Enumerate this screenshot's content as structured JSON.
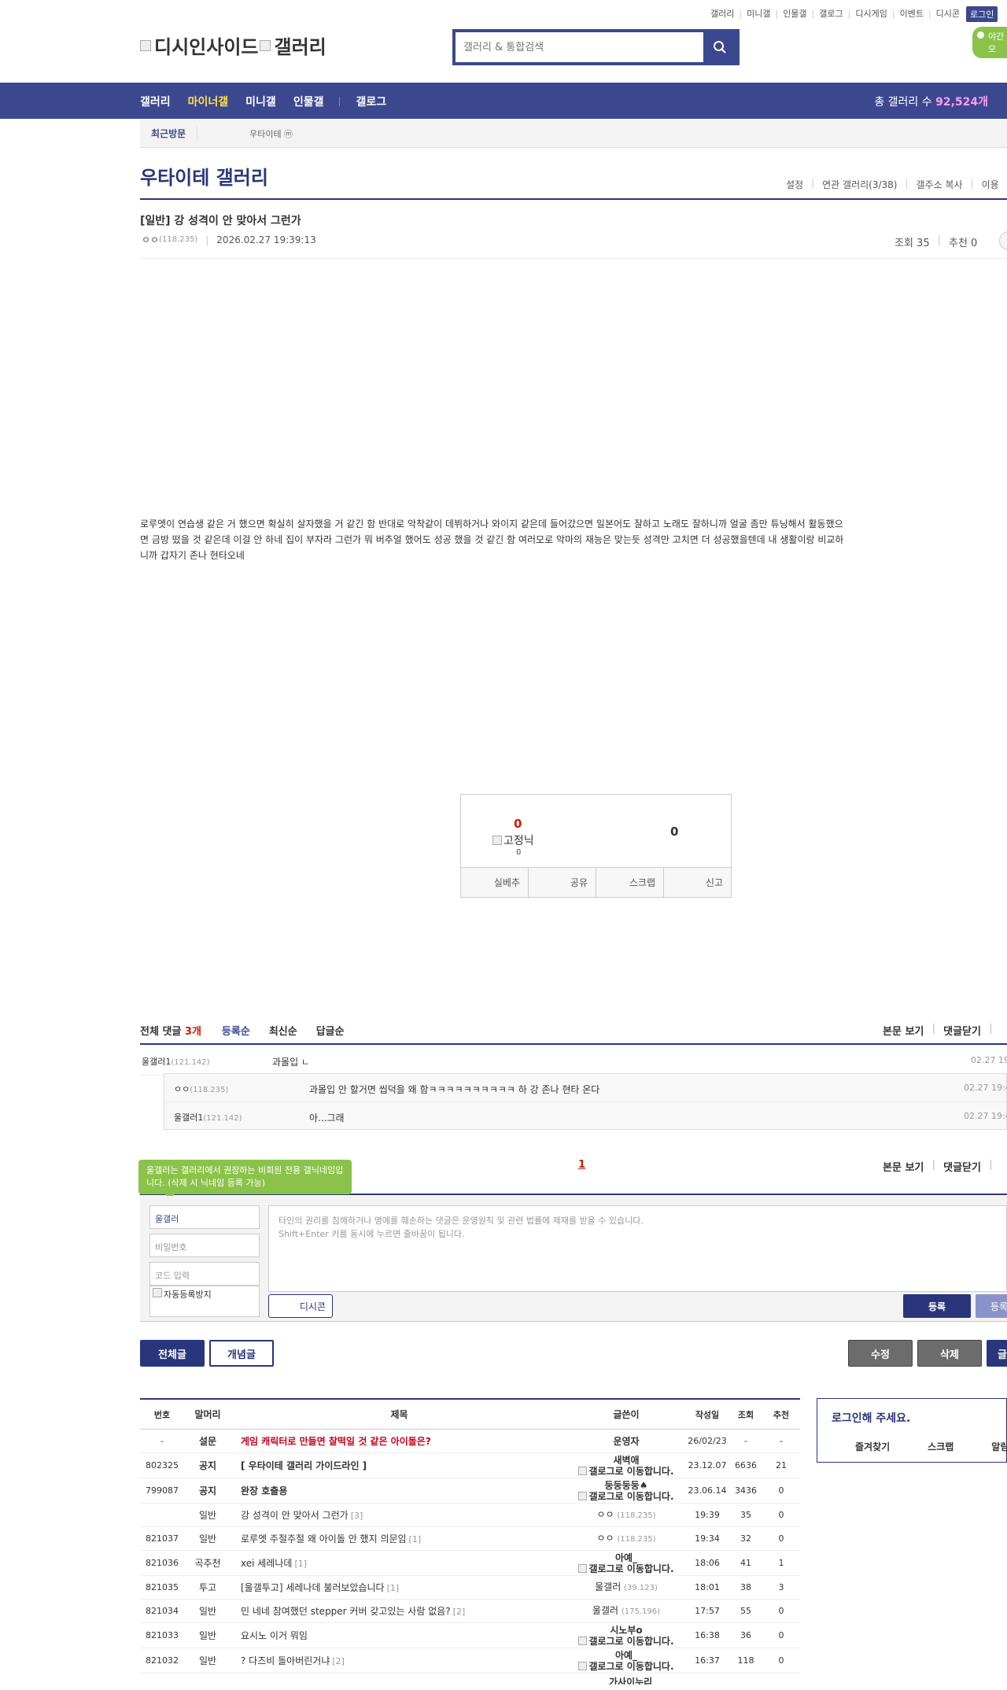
{
  "top_util": [
    "갤러리",
    "미니갤",
    "인물갤",
    "갤로그",
    "디시게임",
    "이벤트",
    "디시콘"
  ],
  "login_label": "로그인",
  "night_label": "야간 모",
  "logo": {
    "part1": "디시인사이드",
    "part2": "갤러리"
  },
  "search": {
    "placeholder": "갤러리 & 통합검색"
  },
  "nav": {
    "items": [
      "갤러리",
      "마이너갤",
      "미니갤",
      "인물갤"
    ],
    "gallog": "갤로그",
    "active": "마이너갤",
    "total_label": "총 갤러리 수",
    "total_value": "92,524개"
  },
  "recent": {
    "label": "최근방문",
    "gallery": "우타이테 ⓜ"
  },
  "gallery": {
    "title": "우타이테 갤러리",
    "tools": [
      "설정",
      "연관 갤러리(3/38)",
      "갤주소 복사",
      "이용"
    ]
  },
  "post": {
    "title": "[일반] 강 성격이 안 맞아서 그런가",
    "author": "ㅇㅇ",
    "ip": "(118.235)",
    "date": "2026.02.27 19:39:13",
    "views": "조회 35",
    "recommend": "추천 0",
    "body": "로루엣이 연습생 같은 거 했으면 확실히 살자했을 거 같긴 함 반대로 악착같이 데뷔하거나 와이지 같은데 들어갔으면 일본어도 잘하고 노래도 잘하니까 얼굴 좀만 튜닝해서 활동했으면 금방 떴을 것 같은데 이걸 안 하네 집이 부자라 그런가 뭐 버추얼 했어도 성공 했을 것 같긴 함 여러모로 악마의 재능은 맞는듯 성격만 고치면 더 성공했을텐데 내 생활이랑 비교하니까 갑자기 존나 현타오네"
  },
  "reco": {
    "up": "0",
    "fixnick": "고정닉",
    "fixnick_count": "0",
    "down": "0",
    "buttons": [
      "실베추",
      "공유",
      "스크랩",
      "신고"
    ]
  },
  "comments": {
    "total_label": "전체 댓글",
    "total_count": "3개",
    "sorts": [
      "등록순",
      "최신순",
      "답글순"
    ],
    "view_body": "본문 보기",
    "close": "댓글닫기",
    "items": [
      {
        "nick": "울갤러1",
        "ip": "(121.142)",
        "text": "과몰입 ㄴ",
        "date": "02.27 19:"
      }
    ],
    "replies": [
      {
        "nick": "ㅇㅇ",
        "ip": "(118.235)",
        "text": "과몰입 안 할거면 씹덕을 왜 함ㅋㅋㅋㅋㅋㅋㅋㅋㅋㅋ 하 강 존나 현타 온다",
        "date": "02.27 19:4"
      },
      {
        "nick": "울갤러1",
        "ip": "(121.142)",
        "text": "아...그래",
        "date": "02.27 19:4"
      }
    ],
    "page": "1"
  },
  "comment_write": {
    "tooltip": "울갤러는 갤러리에서 권장하는 비회원 전용 갤닉네임입니다. (삭제 시 닉네임 등록 가능)",
    "nick": "울갤러",
    "password": "비밀번호",
    "code": "코드 입력",
    "captcha": "자동등록방지",
    "placeholder1": "타인의 권리를 침해하거나 명예를 훼손하는 댓글은 운영원칙 및 관련 법률에 제재를 받을 수 있습니다.",
    "placeholder2": "Shift+Enter 키를 동시에 누르면 줄바꿈이 됩니다.",
    "dccon": "디시콘",
    "register": "등록",
    "register2": "등록"
  },
  "buttons": {
    "all": "전체글",
    "concept": "개념글",
    "edit": "수정",
    "delete": "삭제",
    "write": "글"
  },
  "list": {
    "headers": [
      "번호",
      "말머리",
      "제목",
      "글쓴이",
      "작성일",
      "조회",
      "추천"
    ],
    "rows": [
      {
        "num": "-",
        "head": "설문",
        "title": "게임 캐릭터로 만들면 찰떡일 것 같은 아이돌은?",
        "reply": "",
        "writer": "운영자",
        "writer_ip": "",
        "gallog": false,
        "date": "26/02/23",
        "views": "-",
        "rec": "-",
        "type": "survey"
      },
      {
        "num": "802325",
        "head": "공지",
        "title": "[ 우타이테 갤러리 가이드라인 ]",
        "reply": "",
        "writer": "새벽애",
        "writer_ip": "",
        "gallog": true,
        "date": "23.12.07",
        "views": "6636",
        "rec": "21",
        "type": "notice"
      },
      {
        "num": "799087",
        "head": "공지",
        "title": "완장 호출용",
        "reply": "",
        "writer": "둥둥둥둥♠",
        "writer_ip": "",
        "gallog": true,
        "date": "23.06.14",
        "views": "3436",
        "rec": "0",
        "type": "notice"
      },
      {
        "num": "",
        "head": "일반",
        "title": "강 성격이 안 맞아서 그런가",
        "reply": "[3]",
        "writer": "ㅇㅇ",
        "writer_ip": "(118.235)",
        "gallog": false,
        "date": "19:39",
        "views": "35",
        "rec": "0",
        "type": "current"
      },
      {
        "num": "821037",
        "head": "일반",
        "title": "로루엣 주절주절 왜 아이돌 안 했지 의문임",
        "reply": "[1]",
        "writer": "ㅇㅇ",
        "writer_ip": "(118.235)",
        "gallog": false,
        "date": "19:34",
        "views": "32",
        "rec": "0",
        "type": "normal"
      },
      {
        "num": "821036",
        "head": "곡추천",
        "title": "xei 세레나데",
        "reply": "[1]",
        "writer": "아예_",
        "writer_ip": "",
        "gallog": true,
        "date": "18:06",
        "views": "41",
        "rec": "1",
        "type": "normal"
      },
      {
        "num": "821035",
        "head": "투고",
        "title": "[울갤투고] 세레나데 불러보았습니다",
        "reply": "[1]",
        "writer": "울갤러",
        "writer_ip": "(39.123)",
        "gallog": false,
        "date": "18:01",
        "views": "38",
        "rec": "3",
        "type": "normal"
      },
      {
        "num": "821034",
        "head": "일반",
        "title": "민 네네 참여했던 stepper 커버 갖고있는 사람 없음?",
        "reply": "[2]",
        "writer": "울갤러",
        "writer_ip": "(175.196)",
        "gallog": false,
        "date": "17:57",
        "views": "55",
        "rec": "0",
        "type": "normal"
      },
      {
        "num": "821033",
        "head": "일반",
        "title": "요시노 이거 뭐임",
        "reply": "",
        "writer": "시노부o",
        "writer_ip": "",
        "gallog": true,
        "date": "16:38",
        "views": "36",
        "rec": "0",
        "type": "normal"
      },
      {
        "num": "821032",
        "head": "일반",
        "title": "? 다즈비 돌아버린거냐",
        "reply": "[2]",
        "writer": "아예_",
        "writer_ip": "",
        "gallog": true,
        "date": "16:37",
        "views": "118",
        "rec": "0",
        "type": "normal"
      }
    ],
    "gallog_alt": "갤로그로 이동합니다.",
    "next_writer_partial": "가사이누리"
  },
  "login_box": {
    "title": "로그인해 주세요.",
    "links": [
      "즐겨찾기",
      "스크랩",
      "알림"
    ]
  }
}
